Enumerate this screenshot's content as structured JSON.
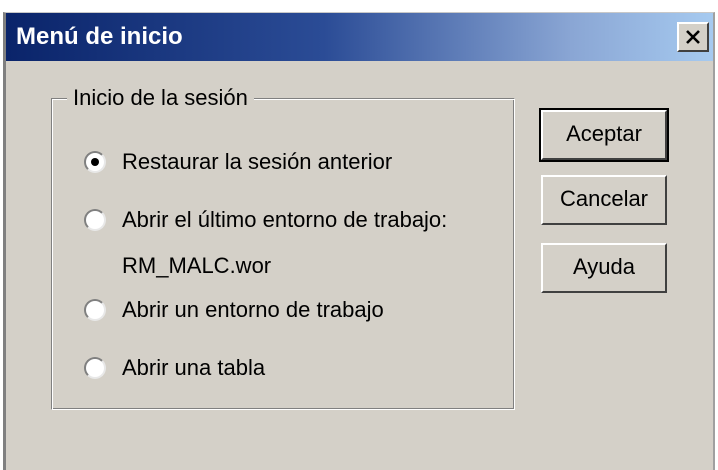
{
  "window": {
    "title": "Menú de inicio",
    "close_label": "Close",
    "title_colors": [
      "#0a246a",
      "#a6caf0"
    ]
  },
  "group": {
    "legend": "Inicio de la sesión",
    "options": [
      {
        "label": "Restaurar la sesión anterior",
        "selected": true
      },
      {
        "label": "Abrir el último entorno de trabajo:",
        "sub_label": "RM_MALC.wor",
        "selected": false
      },
      {
        "label": "Abrir un entorno de trabajo",
        "selected": false
      },
      {
        "label": "Abrir una tabla",
        "selected": false
      }
    ]
  },
  "buttons": {
    "accept": "Aceptar",
    "cancel": "Cancelar",
    "help": "Ayuda"
  },
  "icons": {
    "close": "close-icon",
    "radio_selected": "radio-selected-icon"
  }
}
